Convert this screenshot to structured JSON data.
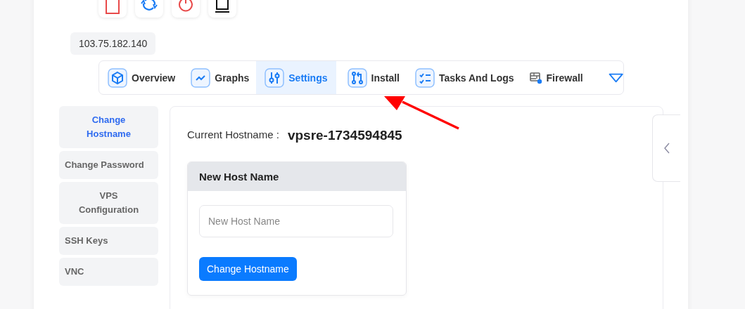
{
  "ip_address": "103.75.182.140",
  "tabs": [
    {
      "label": "Overview",
      "selected": false
    },
    {
      "label": "Graphs",
      "selected": false
    },
    {
      "label": "Settings",
      "selected": true
    },
    {
      "label": "Install",
      "selected": false
    },
    {
      "label": "Tasks And Logs",
      "selected": false
    },
    {
      "label": "Firewall",
      "selected": false
    }
  ],
  "sidebar": {
    "items": [
      {
        "label": "Change Hostname",
        "selected": true
      },
      {
        "label": "Change Password",
        "selected": false
      },
      {
        "label": "VPS Configuration",
        "selected": false
      },
      {
        "label": "SSH Keys",
        "selected": false
      },
      {
        "label": "VNC",
        "selected": false
      }
    ]
  },
  "current_hostname": {
    "label": "Current Hostname :",
    "value": "vpsre-1734594845"
  },
  "new_host_name": {
    "title": "New Host Name",
    "placeholder": "New Host Name",
    "button": "Change Hostname"
  }
}
